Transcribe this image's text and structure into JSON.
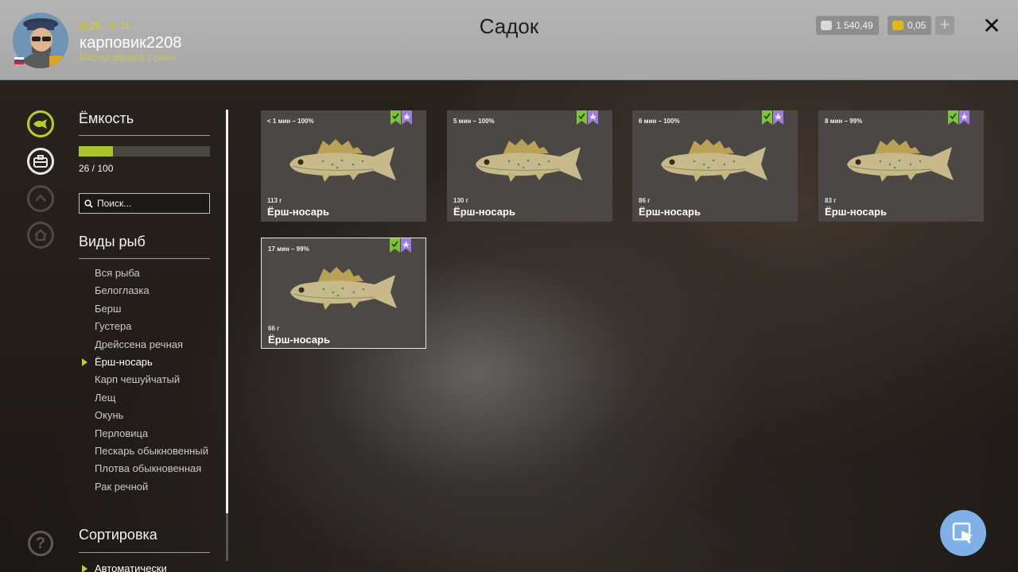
{
  "header": {
    "level": "25",
    "stars": "11",
    "username": "карповик2208",
    "rank": "Мастер фидера 2 ранга",
    "title": "Садок",
    "silver": "1 540,49",
    "gold": "0,05",
    "plus_label": "+",
    "close_label": "✕"
  },
  "sidebar": {
    "capacity_heading": "Ёмкость",
    "capacity_text": "26 / 100",
    "capacity_fraction": 0.26,
    "search_placeholder": "Поиск...",
    "species_heading": "Виды рыб",
    "species": [
      {
        "label": "Вся рыба",
        "active": false
      },
      {
        "label": "Белоглазка",
        "active": false
      },
      {
        "label": "Берш",
        "active": false
      },
      {
        "label": "Густера",
        "active": false
      },
      {
        "label": "Дрейссена речная",
        "active": false
      },
      {
        "label": "Ёрш-носарь",
        "active": true
      },
      {
        "label": "Карп чешуйчатый",
        "active": false
      },
      {
        "label": "Лещ",
        "active": false
      },
      {
        "label": "Окунь",
        "active": false
      },
      {
        "label": "Перловица",
        "active": false
      },
      {
        "label": "Пескарь обыкновенный",
        "active": false
      },
      {
        "label": "Плотва обыкновенная",
        "active": false
      },
      {
        "label": "Рак речной",
        "active": false
      }
    ],
    "sort_heading": "Сортировка",
    "sort_value": "Автоматически"
  },
  "rail_icons": [
    "fish-icon",
    "tackle-box-icon",
    "rank-icon",
    "home-icon",
    "help-icon"
  ],
  "cards": [
    {
      "time": "< 1 мин – 100%",
      "weight": "113 г",
      "name": "Ёрш-носарь",
      "selected": false
    },
    {
      "time": "5 мин – 100%",
      "weight": "130 г",
      "name": "Ёрш-носарь",
      "selected": false
    },
    {
      "time": "6 мин – 100%",
      "weight": "86 г",
      "name": "Ёрш-носарь",
      "selected": false
    },
    {
      "time": "8 мин – 99%",
      "weight": "83 г",
      "name": "Ёрш-носарь",
      "selected": false
    },
    {
      "time": "17 мин – 99%",
      "weight": "66 г",
      "name": "Ёрш-носарь",
      "selected": true
    }
  ],
  "colors": {
    "accent": "#b8d02a",
    "badge_green": "#7cc33a",
    "badge_purple": "#9b7be0",
    "fab": "#7fb1e8"
  }
}
